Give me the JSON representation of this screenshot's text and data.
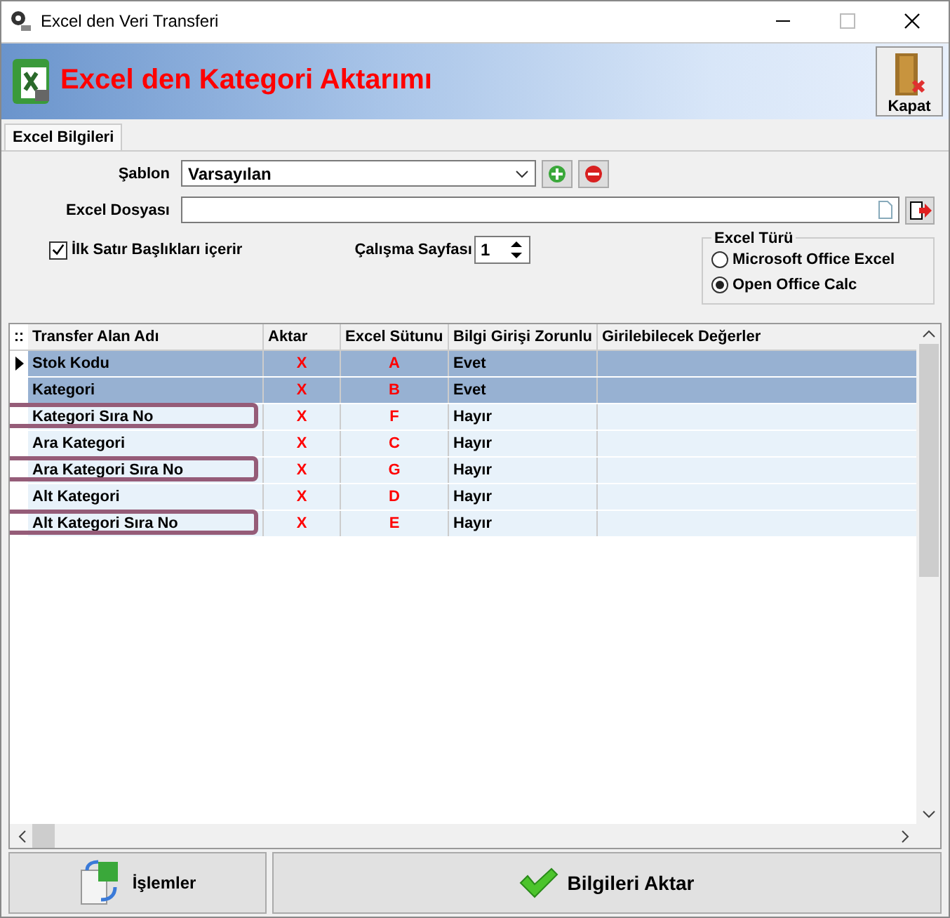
{
  "window": {
    "title": "Excel den Veri Transferi"
  },
  "header": {
    "title": "Excel den Kategori Aktarımı",
    "close_button": "Kapat"
  },
  "tabs": [
    {
      "label": "Excel Bilgileri",
      "selected": true
    }
  ],
  "form": {
    "template_label": "Şablon",
    "template_value": "Varsayılan",
    "file_label": "Excel Dosyası",
    "first_row_headers": {
      "label": "İlk Satır Başlıkları içerir",
      "checked": true
    },
    "sheet_label": "Çalışma Sayfası",
    "sheet_value": "1",
    "excel_type": {
      "title": "Excel Türü",
      "options": [
        {
          "label": "Microsoft Office Excel",
          "selected": false
        },
        {
          "label": "Open Office Calc",
          "selected": true
        }
      ]
    }
  },
  "table": {
    "columns": [
      "Transfer Alan Adı",
      "Aktar",
      "Excel Sütunu",
      "Bilgi Girişi Zorunlu",
      "Girilebilecek Değerler"
    ],
    "rows": [
      {
        "current": true,
        "selected": true,
        "highlighted": false,
        "cells": [
          "Stok Kodu",
          "X",
          "A",
          "Evet"
        ]
      },
      {
        "current": false,
        "selected": true,
        "highlighted": false,
        "cells": [
          "Kategori",
          "X",
          "B",
          "Evet"
        ]
      },
      {
        "current": false,
        "selected": false,
        "highlighted": true,
        "cells": [
          "Kategori Sıra No",
          "X",
          "F",
          "Hayır"
        ]
      },
      {
        "current": false,
        "selected": false,
        "highlighted": false,
        "cells": [
          "Ara Kategori",
          "X",
          "C",
          "Hayır"
        ]
      },
      {
        "current": false,
        "selected": false,
        "highlighted": true,
        "cells": [
          "Ara Kategori Sıra No",
          "X",
          "G",
          "Hayır"
        ]
      },
      {
        "current": false,
        "selected": false,
        "highlighted": false,
        "cells": [
          "Alt Kategori",
          "X",
          "D",
          "Hayır"
        ]
      },
      {
        "current": false,
        "selected": false,
        "highlighted": true,
        "cells": [
          "Alt Kategori Sıra No",
          "X",
          "E",
          "Hayır"
        ]
      }
    ]
  },
  "buttons": [
    {
      "kind": "operations",
      "label": "İşlemler"
    },
    {
      "kind": "transfer",
      "label": "Bilgileri Aktar"
    }
  ]
}
